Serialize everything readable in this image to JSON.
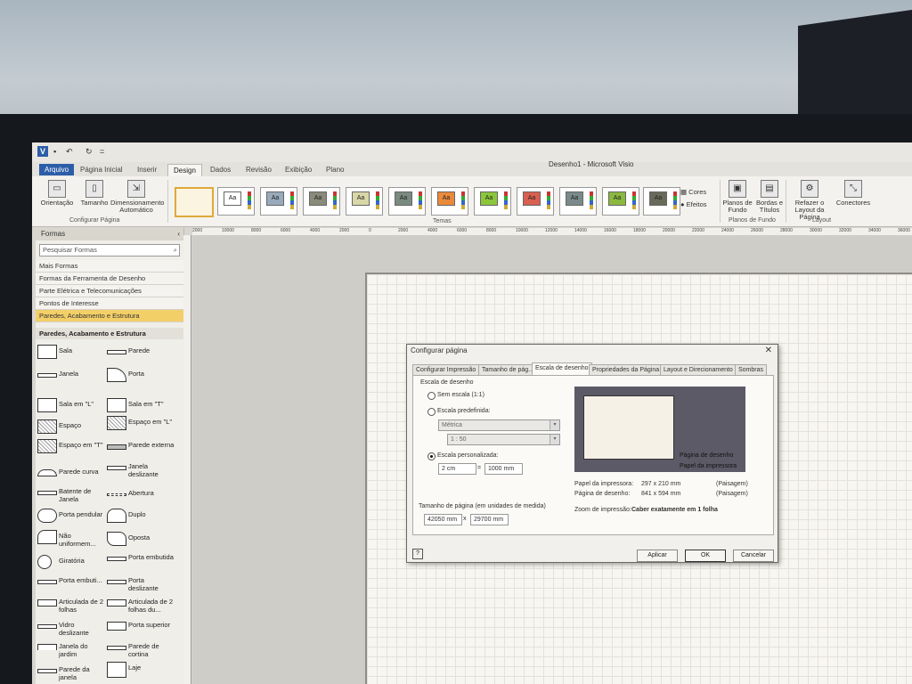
{
  "window": {
    "title": "Desenho1 - Microsoft Visio"
  },
  "qat": {
    "undo": "↶",
    "redo": "↻",
    "more": "="
  },
  "tabs": [
    "Arquivo",
    "Página Inicial",
    "Inserir",
    "Design",
    "Dados",
    "Revisão",
    "Exibição",
    "Plano"
  ],
  "ribbon": {
    "orientacao": "Orientação",
    "tamanho": "Tamanho",
    "dimensionamento": "Dimensionamento Automático",
    "group_configurar": "Configurar Página",
    "group_temas": "Temas",
    "cores": "Cores",
    "efeitos": "Efeitos",
    "planos": "Planos de Fundo",
    "bordas": "Bordas e Títulos",
    "group_planos": "Planos de Fundo",
    "refazer": "Refazer o Layout da Página",
    "conectores": "Conectores",
    "group_layout": "Layout",
    "theme_label": "Aa"
  },
  "shapes_panel": {
    "header": "Formas",
    "search_placeholder": "Pesquisar Formas",
    "stencils": [
      "Mais Formas",
      "Formas da Ferramenta de Desenho",
      "Parte Elétrica e Telecomunicações",
      "Pontos de Interesse",
      "Paredes, Acabamento e Estrutura"
    ],
    "active_stencil": "Paredes, Acabamento e Estrutura",
    "shapes": [
      "Sala",
      "Parede",
      "Janela",
      "Porta",
      "Sala em \"L\"",
      "Sala em \"T\"",
      "Espaço",
      "Espaço em \"L\"",
      "Espaço em \"T\"",
      "Parede externa",
      "Parede curva",
      "Janela deslizante",
      "Batente de Janela",
      "Abertura",
      "Porta pendular",
      "Duplo",
      "Não uniformem...",
      "Oposta",
      "Giratória",
      "Porta embutida",
      "Porta embuti...",
      "Porta deslizante",
      "Articulada de 2 folhas",
      "Articulada de 2 folhas du...",
      "Vidro deslizante",
      "Porta superior",
      "Janela do jardim",
      "Parede de cortina",
      "Parede da janela",
      "Laje"
    ]
  },
  "ruler": [
    "2000",
    "10000",
    "8000",
    "6000",
    "4000",
    "2000",
    "0",
    "2000",
    "4000",
    "6000",
    "8000",
    "10000",
    "12000",
    "14000",
    "16000",
    "18000",
    "20000",
    "22000",
    "24000",
    "26000",
    "28000",
    "30000",
    "32000",
    "34000",
    "36000"
  ],
  "dialog": {
    "title": "Configurar página",
    "close": "✕",
    "tabs": [
      "Configurar Impressão",
      "Tamanho de pág...",
      "Escala de desenho",
      "Propriedades da Página",
      "Layout e Direcionamento",
      "Sombras"
    ],
    "section": "Escala de desenho",
    "opt_none": "Sem escala (1:1)",
    "opt_predef": "Escala predefinida:",
    "predef_unit": "Métrica",
    "predef_ratio": "1 : 50",
    "opt_custom": "Escala personalizada:",
    "custom_left": "2 cm",
    "equals": "=",
    "custom_right": "1000 mm",
    "size_label": "Tamanho de página (em unidades de medida)",
    "size_w": "42050 mm",
    "times": "x",
    "size_h": "29700 mm",
    "legend_drawing": "Página de desenho",
    "legend_printer": "Papel da impressora",
    "info_printer_label": "Papel da impressora:",
    "info_printer_value": "297 x 210 mm",
    "info_printer_orient": "(Paisagem)",
    "info_drawing_label": "Página de desenho:",
    "info_drawing_value": "841 x 594 mm",
    "info_drawing_orient": "(Paisagem)",
    "zoom_label": "Zoom de impressão:",
    "zoom_value": "Caber exatamente em 1 folha",
    "help": "?",
    "btn_apply": "Aplicar",
    "btn_ok": "OK",
    "btn_cancel": "Cancelar"
  },
  "colors": {
    "accent": "#2c5ea8",
    "selected_stencil": "#f3cf68"
  }
}
